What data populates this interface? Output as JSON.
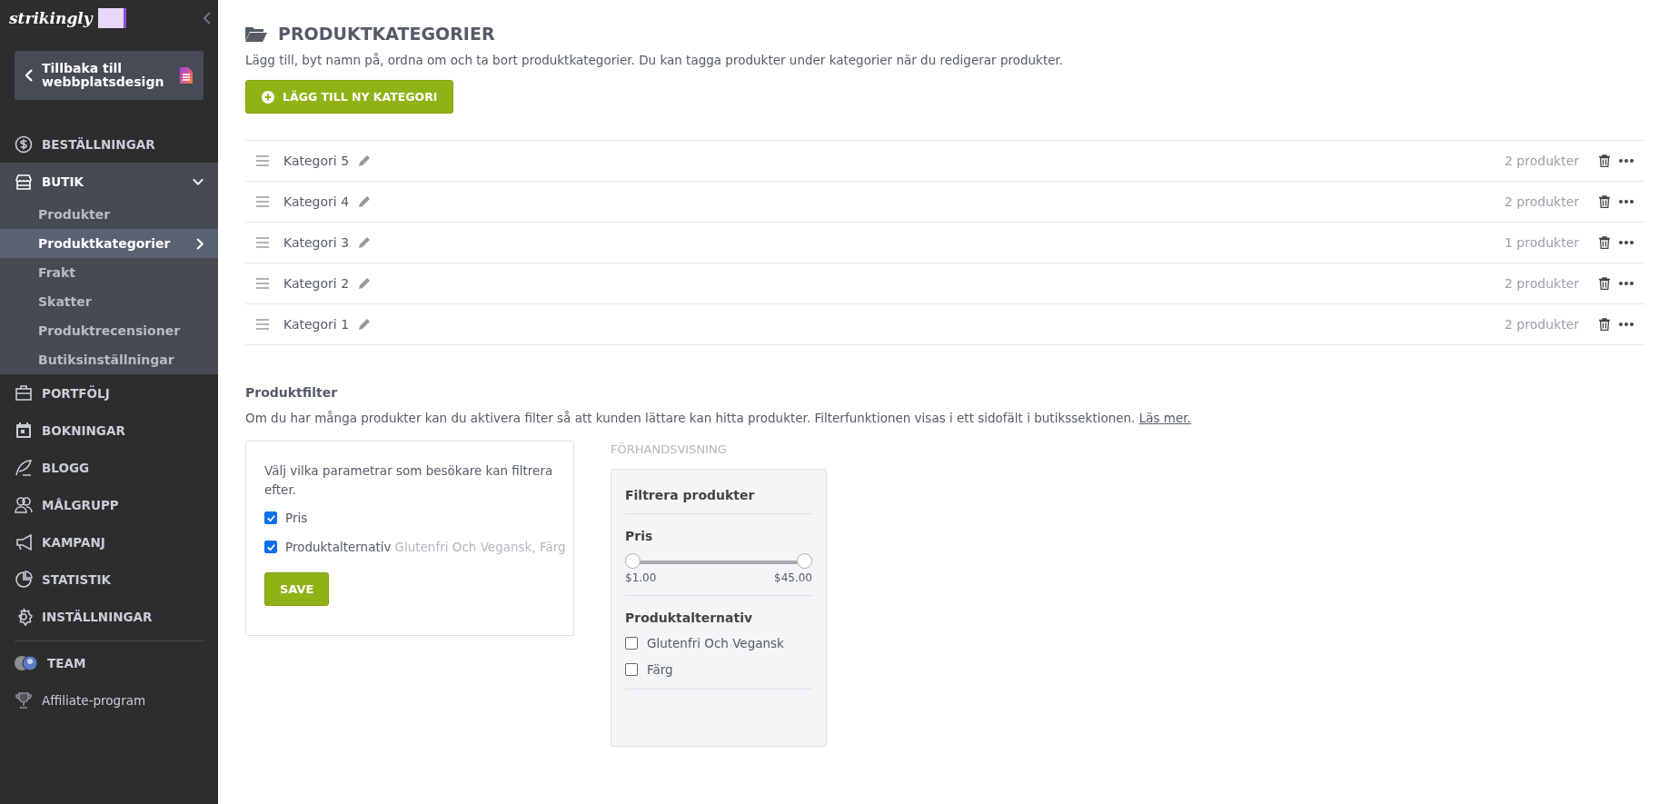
{
  "sidebar": {
    "logo": "strikingly",
    "back_button": "Tillbaka till webbplatsdesign",
    "items": [
      {
        "label": "BESTÄLLNINGAR",
        "kind": "section"
      },
      {
        "label": "BUTIK",
        "kind": "section",
        "expanded": true,
        "children": [
          {
            "label": "Produkter",
            "selected": false
          },
          {
            "label": "Produktkategorier",
            "selected": true
          },
          {
            "label": "Frakt",
            "selected": false
          },
          {
            "label": "Skatter",
            "selected": false
          },
          {
            "label": "Produktrecensioner",
            "selected": false
          },
          {
            "label": "Butiksinställningar",
            "selected": false
          }
        ]
      },
      {
        "label": "PORTFÖLJ",
        "kind": "section"
      },
      {
        "label": "BOKNINGAR",
        "kind": "section"
      },
      {
        "label": "BLOGG",
        "kind": "section"
      },
      {
        "label": "MÅLGRUPP",
        "kind": "section"
      },
      {
        "label": "KAMPANJ",
        "kind": "section"
      },
      {
        "label": "STATISTIK",
        "kind": "section"
      },
      {
        "label": "INSTÄLLNINGAR",
        "kind": "section"
      },
      {
        "label": "TEAM",
        "kind": "team"
      },
      {
        "label": "Affiliate-program",
        "kind": "link"
      }
    ]
  },
  "page": {
    "title": "PRODUKTKATEGORIER",
    "description": "Lägg till, byt namn på, ordna om och ta bort produktkategorier. Du kan tagga produkter under kategorier när du redigerar produkter.",
    "add_button": "LÄGG TILL NY KATEGORI"
  },
  "categories": [
    {
      "name": "Kategori 5",
      "count": "2 produkter"
    },
    {
      "name": "Kategori 4",
      "count": "2 produkter"
    },
    {
      "name": "Kategori 3",
      "count": "1 produkter"
    },
    {
      "name": "Kategori 2",
      "count": "2 produkter"
    },
    {
      "name": "Kategori 1",
      "count": "2 produkter"
    }
  ],
  "filter": {
    "title": "Produktfilter",
    "description": "Om du har många produkter kan du aktivera filter så att kunden lättare kan hitta produkter. Filterfunktionen visas i ett sidofält i butikssektionen.",
    "read_more": "Läs mer.",
    "prompt": "Välj vilka parametrar som besökare kan filtrera efter.",
    "options": [
      {
        "label": "Pris",
        "checked": true
      },
      {
        "label": "Produktalternativ",
        "detail": "Glutenfri Och Vegansk, Färg",
        "checked": true
      }
    ],
    "save_button": "SAVE"
  },
  "preview": {
    "label": "FÖRHANDSVISNING",
    "title": "Filtrera produkter",
    "price_heading": "Pris",
    "price": {
      "level": 1,
      "min": "$1.00",
      "max": "$45.00"
    },
    "options_heading": "Produktalternativ",
    "options": [
      {
        "label": "Glutenfri Och Vegansk",
        "checked": false
      },
      {
        "label": "Färg",
        "checked": false
      }
    ]
  }
}
